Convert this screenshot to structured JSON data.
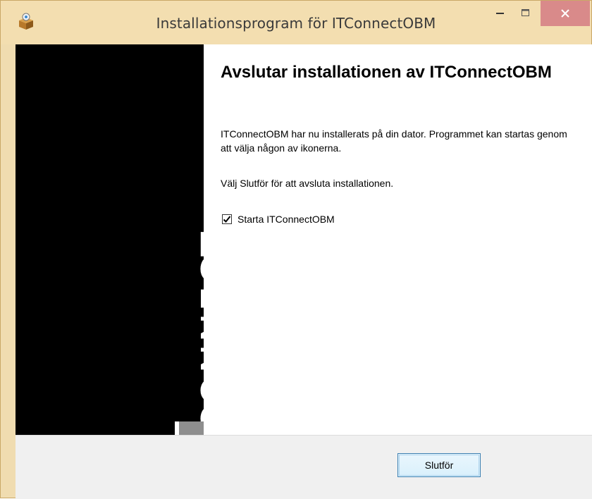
{
  "window": {
    "title": "Installationsprogram för ITConnectOBM",
    "accent_color": "#f3deb0",
    "close_button_color": "#d98a8a"
  },
  "titlebar_icons": {
    "app": "installer-box-icon",
    "minimize": "minimize-icon",
    "maximize": "maximize-icon",
    "close": "close-icon"
  },
  "banner": {
    "logo_text": "CONNECT"
  },
  "content": {
    "heading": "Avslutar installationen av ITConnectOBM",
    "paragraph_1": "ITConnectOBM har nu installerats på din dator. Programmet kan startas genom att välja någon av ikonerna.",
    "paragraph_2": "Välj Slutför för att avsluta installationen.",
    "launch_checkbox": {
      "label": "Starta ITConnectOBM",
      "checked": true
    }
  },
  "footer": {
    "finish_label": "Slutför"
  }
}
